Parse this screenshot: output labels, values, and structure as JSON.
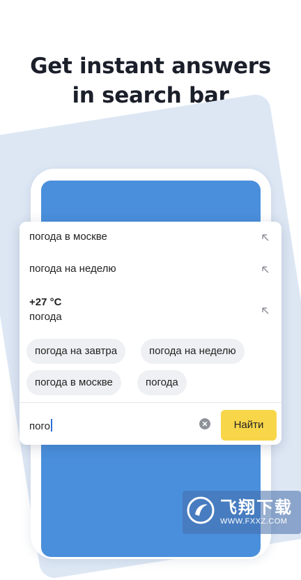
{
  "headline": {
    "line1": "Get instant answers",
    "line2": "in search bar"
  },
  "suggestions": [
    {
      "label": "погода в москве",
      "icon": "arrow-up-left-icon"
    },
    {
      "label": "погода на неделю",
      "icon": "arrow-up-left-icon"
    }
  ],
  "weather": {
    "temp": "+27 °C",
    "label": "погода",
    "icon": "arrow-up-left-icon"
  },
  "chips": [
    "погода на завтра",
    "погода на неделю",
    "погода в москве",
    "погода"
  ],
  "search": {
    "value": "пого",
    "clear_icon": "clear-icon",
    "button_label": "Найти"
  },
  "watermark": {
    "title": "飞翔下载",
    "url": "WWW.FXXZ.COM"
  },
  "colors": {
    "accent_button": "#f8d64a",
    "screen_blue": "#4a8fdc",
    "background_card": "#dde7f4",
    "caret": "#2e6fd6"
  }
}
